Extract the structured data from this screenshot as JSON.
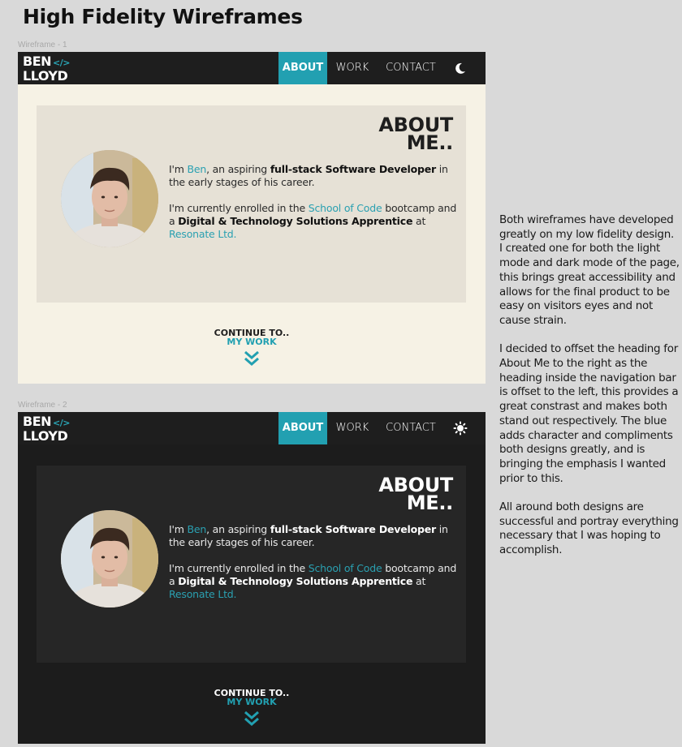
{
  "page_title": "High Fidelity Wireframes",
  "wireframes": [
    {
      "label": "Wireframe - 1",
      "mode": "light",
      "logo": {
        "line1": "BEN",
        "code": "</>",
        "line2": "LLOYD"
      },
      "nav": {
        "about": "ABOUT",
        "work": "WORK",
        "contact": "CONTACT",
        "toggle_icon": "moon-icon"
      },
      "heading": {
        "line1": "ABOUT",
        "line2": "ME.."
      },
      "bio": {
        "p1_a": "I'm ",
        "name": "Ben",
        "p1_b": ", an aspiring ",
        "role": "full-stack Software Developer",
        "p1_c": " in the early stages of his career.",
        "p2_a": "I'm currently enrolled in the ",
        "school": "School of Code",
        "p2_b": " bootcamp and a ",
        "apprentice": "Digital & Technology Solutions Apprentice",
        "p2_c": " at ",
        "company": "Resonate Ltd."
      },
      "continue": {
        "line1": "CONTINUE TO..",
        "line2": "MY WORK"
      }
    },
    {
      "label": "Wireframe - 2",
      "mode": "dark",
      "logo": {
        "line1": "BEN",
        "code": "</>",
        "line2": "LLOYD"
      },
      "nav": {
        "about": "ABOUT",
        "work": "WORK",
        "contact": "CONTACT",
        "toggle_icon": "sun-icon"
      },
      "heading": {
        "line1": "ABOUT",
        "line2": "ME.."
      },
      "bio": {
        "p1_a": "I'm ",
        "name": "Ben",
        "p1_b": ", an aspiring ",
        "role": "full-stack Software Developer",
        "p1_c": " in the early stages of his career.",
        "p2_a": "I'm currently enrolled in the ",
        "school": "School of Code",
        "p2_b": " bootcamp and a ",
        "apprentice": "Digital & Technology Solutions Apprentice",
        "p2_c": " at ",
        "company": "Resonate Ltd."
      },
      "continue": {
        "line1": "CONTINUE TO..",
        "line2": "MY WORK"
      }
    }
  ],
  "description": {
    "p1": "Both wireframes have developed greatly on my low fidelity design. I created one for both the light mode and dark mode of the page, this brings great accessibility and allows for the final product to be easy on visitors eyes and not cause strain.",
    "p2": "I decided to offset the heading for About Me to the right as the heading inside the navigation bar is offset to the left, this provides a great constrast and makes both stand out respectively. The blue adds character and compliments both designs greatly, and is bringing the emphasis I wanted prior to this.",
    "p3": "All around both designs are successful and portray everything necessary that I was hoping to accomplish."
  },
  "colors": {
    "accent": "#22a0b1",
    "light_bg": "#f6f2e5",
    "light_card": "#e6e1d6",
    "dark_bg": "#1c1c1c",
    "dark_card": "#262626",
    "nav_bg": "#1e1e1e"
  }
}
